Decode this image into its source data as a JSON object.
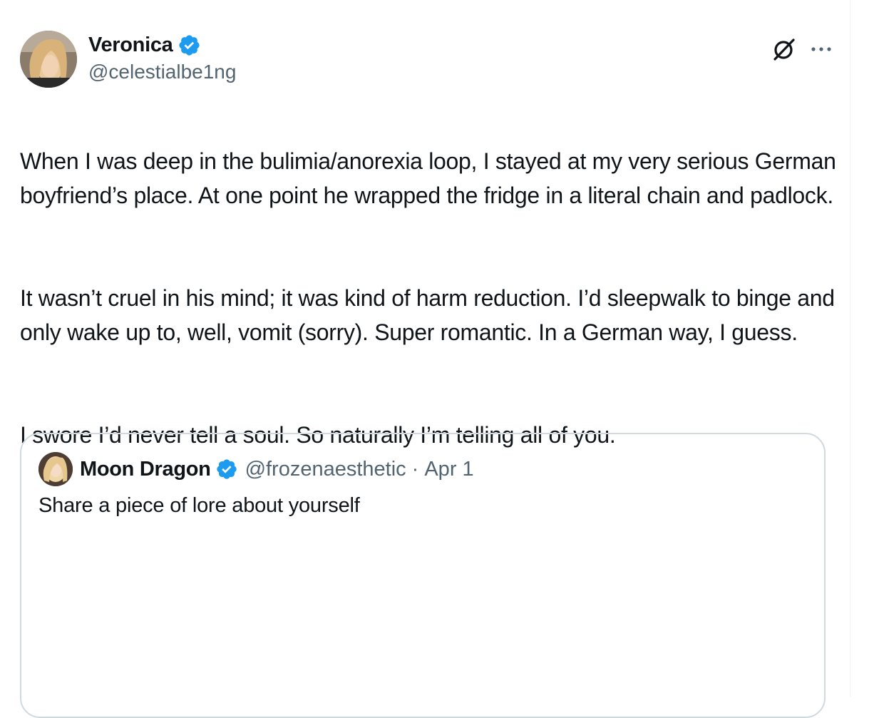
{
  "tweet": {
    "author": {
      "display_name": "Veronica",
      "handle": "@celestialbe1ng",
      "verified": true,
      "avatar": "profile-photo"
    },
    "actions": {
      "grok_icon": "grok-icon",
      "more_icon": "more-options-icon"
    },
    "paragraphs": [
      "When I was deep in the bulimia/anorexia loop, I stayed at my very serious German boyfriend’s place. At one point he wrapped the fridge in a literal chain and padlock.",
      "It wasn’t cruel in his mind; it was kind of harm reduction. I’d sleepwalk to binge and only wake up to, well, vomit (sorry). Super romantic. In a German way, I guess.",
      "I swore I’d never tell a soul. So naturally I’m telling all of you."
    ]
  },
  "quote": {
    "display_name": "Moon Dragon",
    "handle": "@frozenaesthetic",
    "separator": "·",
    "date": "Apr 1",
    "verified": true,
    "text": "Share a piece of lore about yourself"
  },
  "colors": {
    "text": "#0f1419",
    "secondary": "#536471",
    "verified_blue": "#1d9bf0",
    "border": "#cfd9de"
  }
}
